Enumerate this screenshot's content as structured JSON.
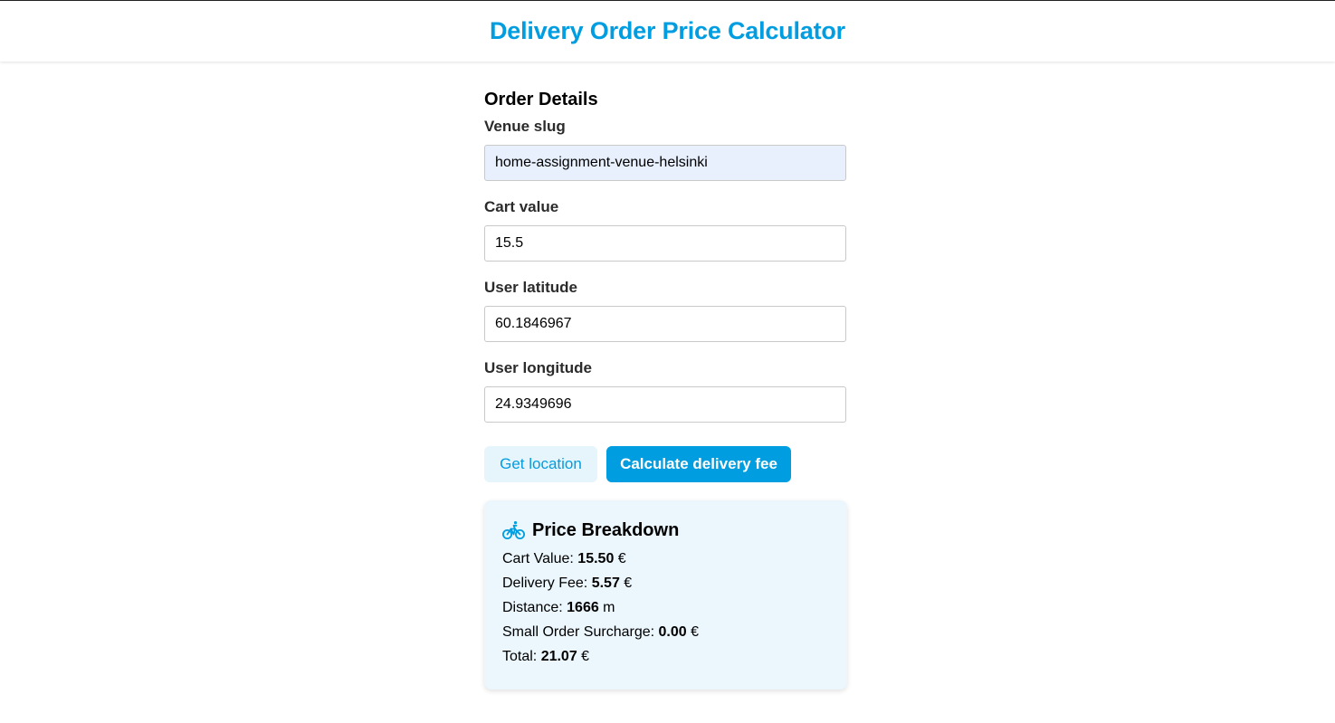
{
  "header": {
    "title": "Delivery Order Price Calculator"
  },
  "form": {
    "title": "Order Details",
    "fields": [
      {
        "label": "Venue slug",
        "value": "home-assignment-venue-helsinki"
      },
      {
        "label": "Cart value",
        "value": "15.5"
      },
      {
        "label": "User latitude",
        "value": "60.1846967"
      },
      {
        "label": "User longitude",
        "value": "24.9349696"
      }
    ],
    "buttons": {
      "get_location": "Get location",
      "calculate": "Calculate delivery fee"
    }
  },
  "breakdown": {
    "icon": "bicycle-icon",
    "title": "Price Breakdown",
    "rows": [
      {
        "label": "Cart Value: ",
        "value": "15.50",
        "unit": " €"
      },
      {
        "label": "Delivery Fee: ",
        "value": "5.57",
        "unit": " €"
      },
      {
        "label": "Distance: ",
        "value": "1666",
        "unit": " m"
      },
      {
        "label": "Small Order Surcharge: ",
        "value": "0.00",
        "unit": " €"
      },
      {
        "label": "Total: ",
        "value": "21.07",
        "unit": " €"
      }
    ]
  },
  "colors": {
    "accent": "#009de0",
    "accent_light": "#e6f5fc",
    "panel_bg": "#ebf6fd",
    "autofill_bg": "#e8f0fe"
  }
}
